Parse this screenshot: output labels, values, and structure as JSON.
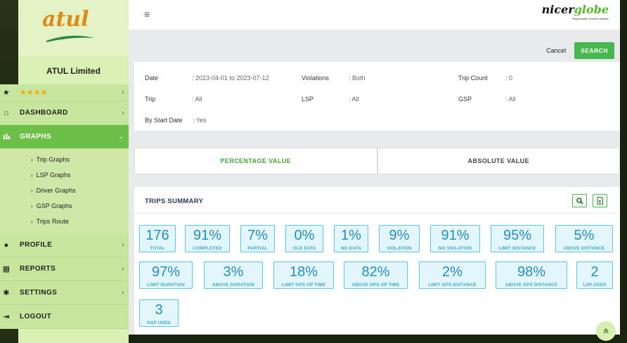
{
  "brand": {
    "logo_text": "atul",
    "company": "ATUL Limited",
    "partner_logo_main": "nicer",
    "partner_logo_accent": "globe",
    "partner_tagline": "Responsible Growth Initiative"
  },
  "sidebar": {
    "rating": "★★★★",
    "items": [
      {
        "label": "DASHBOARD",
        "icon": "home-icon"
      },
      {
        "label": "GRAPHS",
        "icon": "bar-chart-icon",
        "active": true
      },
      {
        "label": "PROFILE",
        "icon": "user-icon"
      },
      {
        "label": "REPORTS",
        "icon": "table-icon"
      },
      {
        "label": "SETTINGS",
        "icon": "gear-icon"
      },
      {
        "label": "LOGOUT",
        "icon": "logout-icon"
      }
    ],
    "submenu": [
      "Trip Graphs",
      "LSP Graphs",
      "Driver Graphs",
      "GSP Graphs",
      "Trips Route"
    ]
  },
  "actions": {
    "cancel": "Cancel",
    "search": "SEARCH"
  },
  "filters": {
    "date_label": "Date",
    "date_value": ": 2023-04-01 to 2023-07-12",
    "violations_label": "Violations",
    "violations_value": ": Both",
    "tripcount_label": "Trip Count",
    "tripcount_value": ": 0",
    "trip_label": "Trip",
    "trip_value": ": All",
    "lsp_label": "LSP",
    "lsp_value": ": All",
    "gsp_label": "GSP",
    "gsp_value": ": All",
    "bystart_label": "By Start Date",
    "bystart_value": ": Yes"
  },
  "toggle": {
    "percentage": "PERCENTAGE VALUE",
    "absolute": "ABSOLUTE VALUE"
  },
  "summary": {
    "title": "TRIPS SUMMARY",
    "cards": [
      {
        "value": "176",
        "label": "TOTAL"
      },
      {
        "value": "91%",
        "label": "COMPLETED"
      },
      {
        "value": "7%",
        "label": "PARTIAL"
      },
      {
        "value": "0%",
        "label": "OLD DATA"
      },
      {
        "value": "1%",
        "label": "NO DATA"
      },
      {
        "value": "9%",
        "label": "VIOLATION"
      },
      {
        "value": "91%",
        "label": "NO VIOLATION"
      },
      {
        "value": "95%",
        "label": "LIMIT DISTANCE"
      },
      {
        "value": "5%",
        "label": "ABOVE DISTANCE"
      },
      {
        "value": "97%",
        "label": "LIMIT DURATION"
      },
      {
        "value": "3%",
        "label": "ABOVE DURATION"
      },
      {
        "value": "18%",
        "label": "LIMIT GPS UP TIME"
      },
      {
        "value": "82%",
        "label": "ABOVE GPS UP TIME"
      },
      {
        "value": "2%",
        "label": "LIMIT GPS DISTANCE"
      },
      {
        "value": "98%",
        "label": "ABOVE GPS DISTANCE"
      },
      {
        "value": "2",
        "label": "LSP USED"
      },
      {
        "value": "3",
        "label": "GSP USED"
      }
    ]
  },
  "colors": {
    "accent_green": "#46b84f",
    "sidebar_bg": "#dbf0b5",
    "card_bg": "#e3f6fd",
    "card_text": "#1f8fbd",
    "logo_orange": "#e08a16"
  }
}
